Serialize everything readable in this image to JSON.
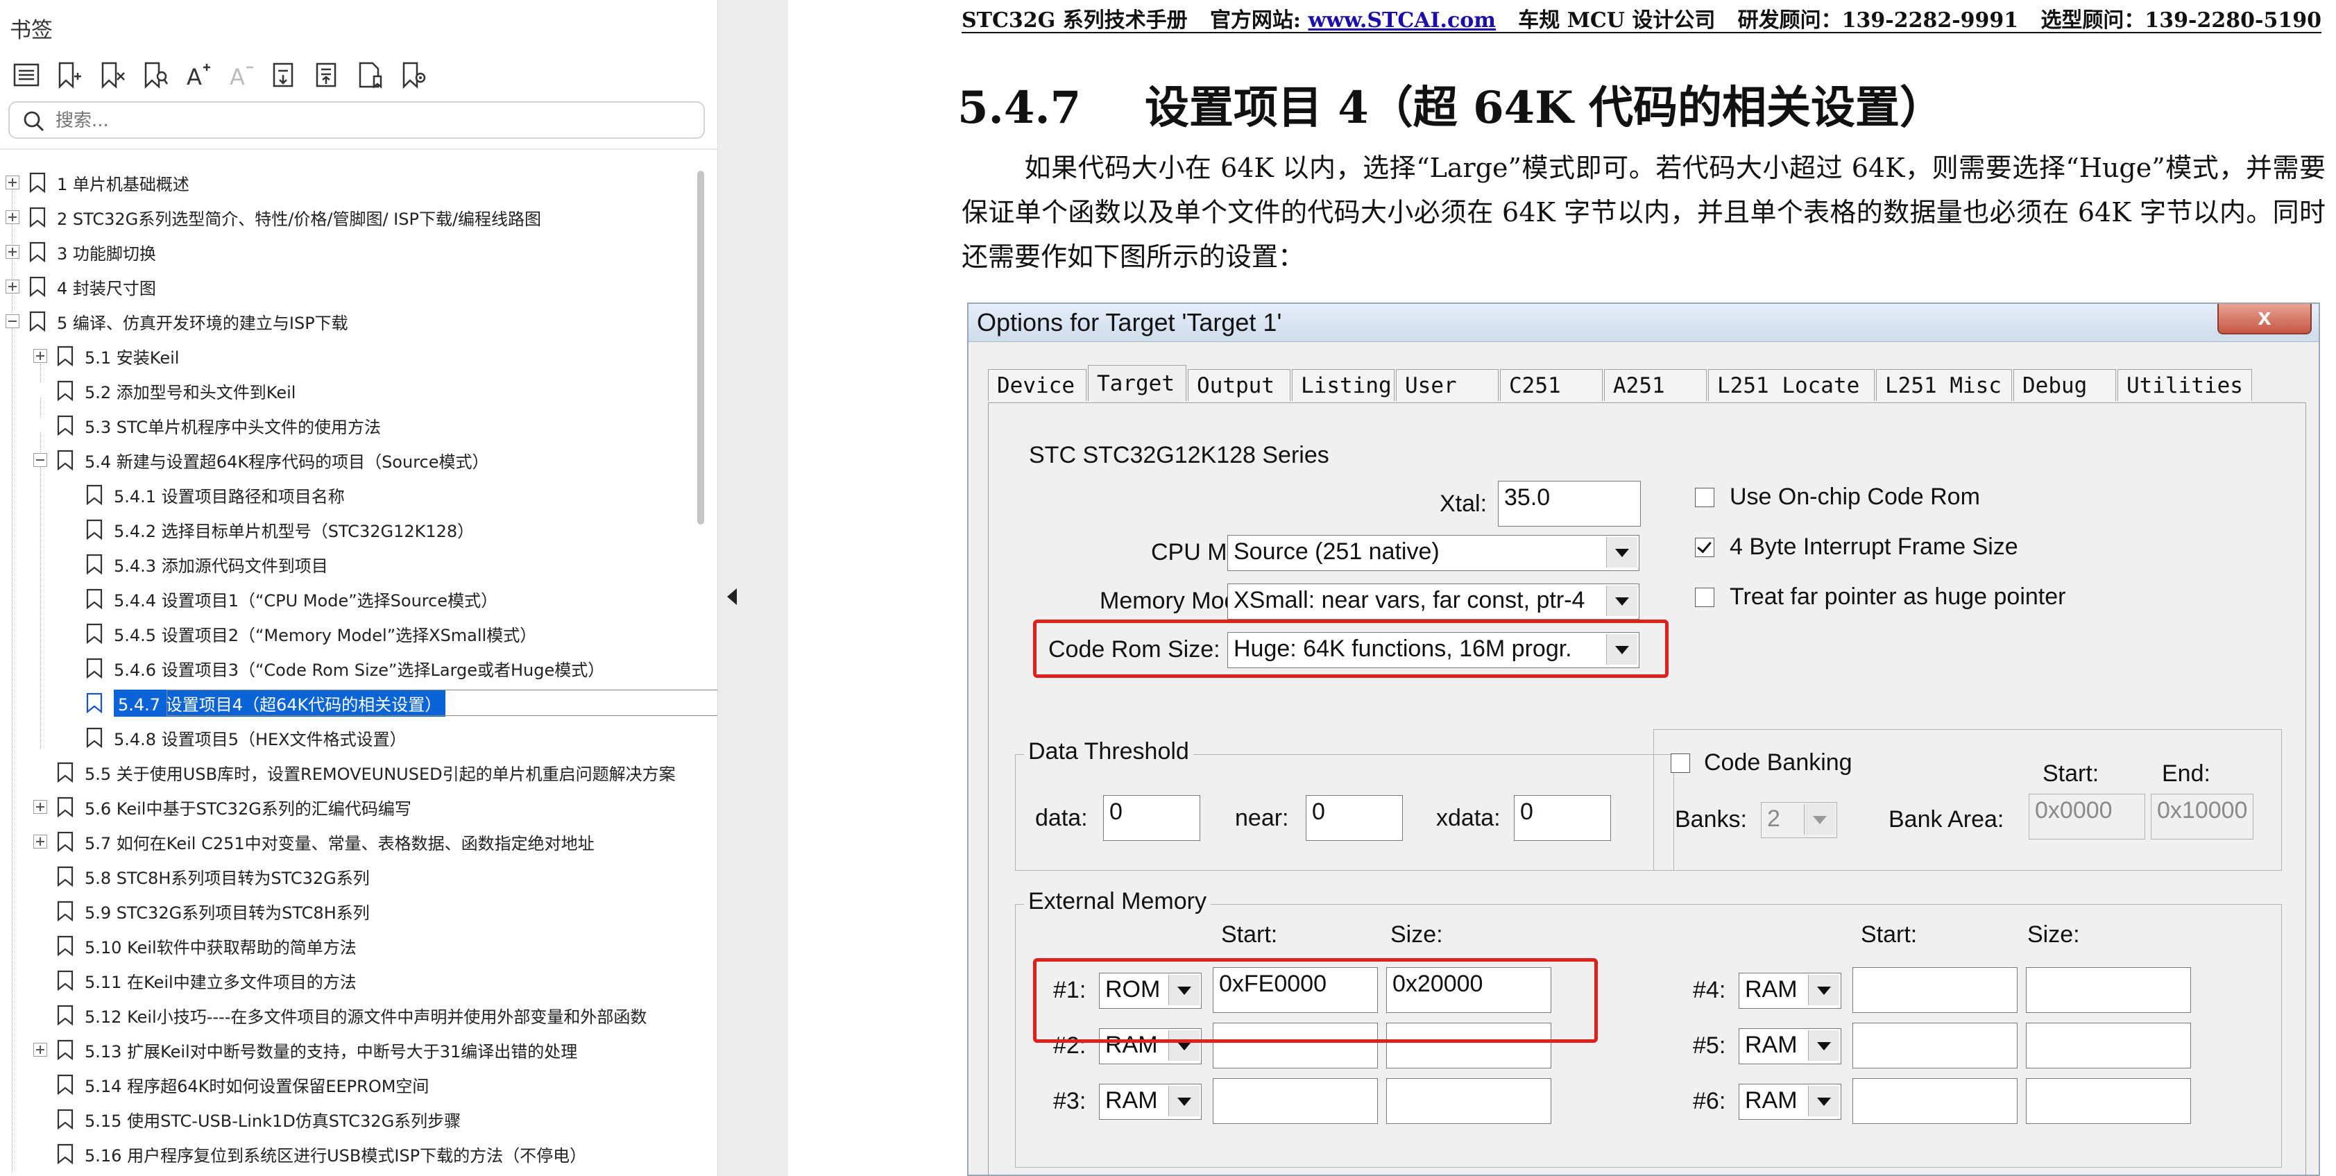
{
  "panel": {
    "title": "书签",
    "search_placeholder": "搜索...",
    "toolbar_icons": [
      "bookmark-list-icon",
      "add-bookmark-icon",
      "delete-bookmark-icon",
      "find-bookmark-icon",
      "enlarge-text-icon",
      "shrink-text-icon",
      "expand-all-icon",
      "collapse-all-icon",
      "bookmark-page-icon",
      "bookmark-settings-icon"
    ],
    "items": [
      {
        "label": "1  单片机基础概述",
        "level": 0,
        "exp": "plus"
      },
      {
        "label": "2  STC32G系列选型简介、特性/价格/管脚图/ ISP下载/编程线路图",
        "level": 0,
        "exp": "plus"
      },
      {
        "label": "3  功能脚切换",
        "level": 0,
        "exp": "plus"
      },
      {
        "label": "4  封装尺寸图",
        "level": 0,
        "exp": "plus"
      },
      {
        "label": "5  编译、仿真开发环境的建立与ISP下载",
        "level": 0,
        "exp": "minus"
      },
      {
        "label": "5.1  安装Keil",
        "level": 1,
        "exp": "plus"
      },
      {
        "label": "5.2  添加型号和头文件到Keil",
        "level": 1,
        "exp": "none"
      },
      {
        "label": "5.3  STC单片机程序中头文件的使用方法",
        "level": 1,
        "exp": "none"
      },
      {
        "label": "5.4  新建与设置超64K程序代码的项目（Source模式）",
        "level": 1,
        "exp": "minus"
      },
      {
        "label": "5.4.1 设置项目路径和项目名称",
        "level": 2,
        "exp": "none"
      },
      {
        "label": "5.4.2 选择目标单片机型号（STC32G12K128）",
        "level": 2,
        "exp": "none"
      },
      {
        "label": "5.4.3 添加源代码文件到项目",
        "level": 2,
        "exp": "none"
      },
      {
        "label": "5.4.4 设置项目1（“CPU Mode”选择Source模式）",
        "level": 2,
        "exp": "none"
      },
      {
        "label": "5.4.5 设置项目2（“Memory Model”选择XSmall模式）",
        "level": 2,
        "exp": "none"
      },
      {
        "label": "5.4.6  设置项目3（“Code Rom Size”选择Large或者Huge模式）",
        "level": 2,
        "exp": "none"
      },
      {
        "label": "5.4.7  设置项目4（超64K代码的相关设置）",
        "level": 2,
        "exp": "none",
        "selected": true
      },
      {
        "label": "5.4.8  设置项目5（HEX文件格式设置）",
        "level": 2,
        "exp": "none"
      },
      {
        "label": "5.5  关于使用USB库时，设置REMOVEUNUSED引起的单片机重启问题解决方案",
        "level": 1,
        "exp": "none"
      },
      {
        "label": "5.6  Keil中基于STC32G系列的汇编代码编写",
        "level": 1,
        "exp": "plus"
      },
      {
        "label": "5.7  如何在Keil C251中对变量、常量、表格数据、函数指定绝对地址",
        "level": 1,
        "exp": "plus"
      },
      {
        "label": "5.8  STC8H系列项目转为STC32G系列",
        "level": 1,
        "exp": "none"
      },
      {
        "label": "5.9  STC32G系列项目转为STC8H系列",
        "level": 1,
        "exp": "none"
      },
      {
        "label": "5.10  Keil软件中获取帮助的简单方法",
        "level": 1,
        "exp": "none"
      },
      {
        "label": "5.11  在Keil中建立多文件项目的方法",
        "level": 1,
        "exp": "none"
      },
      {
        "label": "5.12  Keil小技巧----在多文件项目的源文件中声明并使用外部变量和外部函数",
        "level": 1,
        "exp": "none"
      },
      {
        "label": "5.13  扩展Keil对中断号数量的支持，中断号大于31编译出错的处理",
        "level": 1,
        "exp": "plus"
      },
      {
        "label": "5.14  程序超64K时如何设置保留EEPROM空间",
        "level": 1,
        "exp": "none"
      },
      {
        "label": "5.15  使用STC-USB-Link1D仿真STC32G系列步骤",
        "level": 1,
        "exp": "none"
      },
      {
        "label": "5.16  用户程序复位到系统区进行USB模式ISP下载的方法（不停电）",
        "level": 1,
        "exp": "none"
      }
    ]
  },
  "doc": {
    "header": {
      "left": "STC32G 系列技术手册",
      "site_prefix": "官方网站: ",
      "site": "www.STCAI.com",
      "company": "车规 MCU 设计公司",
      "dev": "研发顾问：139-2282-9991",
      "sel": "选型顾问：139-2280-5190"
    },
    "section_number": "5.4.7",
    "section_title": "设置项目 4（超 64K 代码的相关设置）",
    "paragraph": "如果代码大小在 64K 以内，选择“Large”模式即可。若代码大小超过 64K，则需要选择“Huge”模式，并需要保证单个函数以及单个文件的代码大小必须在 64K 字节以内，并且单个表格的数据量也必须在 64K 字节以内。同时还需要作如下图所示的设置："
  },
  "dialog": {
    "title": "Options for Target 'Target 1'",
    "close": "x",
    "tabs": [
      "Device",
      "Target",
      "Output",
      "Listing",
      "User",
      "C251",
      "A251",
      "L251 Locate",
      "L251 Misc",
      "Debug",
      "Utilities"
    ],
    "active_tab": "Target",
    "device": "STC STC32G12K128 Series",
    "xtal_label": "Xtal:",
    "xtal": "35.0",
    "cpu_label": "CPU Mode:",
    "cpu": "Source (251 native)",
    "mem_label": "Memory Model:",
    "mem": "XSmall: near vars, far const, ptr-4",
    "rom_label": "Code Rom Size:",
    "rom": "Huge: 64K functions, 16M progr.",
    "chk_onchip": "Use On-chip Code Rom",
    "chk_onchip_on": false,
    "chk_frame": "4 Byte Interrupt Frame Size",
    "chk_frame_on": true,
    "chk_far": "Treat far pointer as huge pointer",
    "chk_far_on": false,
    "threshold": {
      "title": "Data Threshold",
      "data_label": "data:",
      "data": "0",
      "near_label": "near:",
      "near": "0",
      "xdata_label": "xdata:",
      "xdata": "0"
    },
    "banking": {
      "label": "Code Banking",
      "on": false,
      "start_label": "Start:",
      "end_label": "End:",
      "banks_label": "Banks:",
      "banks": "2",
      "area_label": "Bank Area:",
      "start": "0x0000",
      "end": "0x10000"
    },
    "ext": {
      "title": "External Memory",
      "start_label": "Start:",
      "size_label": "Size:",
      "rows": [
        {
          "num": "#1:",
          "type": "ROM",
          "start": "0xFE0000",
          "size": "0x20000"
        },
        {
          "num": "#2:",
          "type": "RAM",
          "start": "",
          "size": ""
        },
        {
          "num": "#3:",
          "type": "RAM",
          "start": "",
          "size": ""
        },
        {
          "num": "#4:",
          "type": "RAM",
          "start": "",
          "size": ""
        },
        {
          "num": "#5:",
          "type": "RAM",
          "start": "",
          "size": ""
        },
        {
          "num": "#6:",
          "type": "RAM",
          "start": "",
          "size": ""
        }
      ]
    },
    "highlight_color": "#e0201b"
  }
}
